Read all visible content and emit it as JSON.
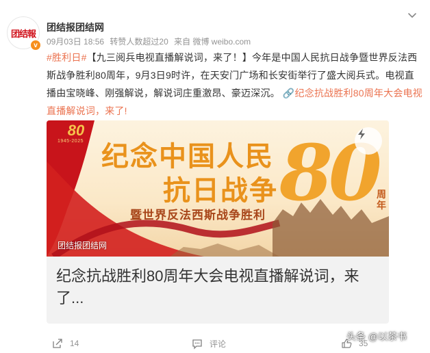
{
  "account": {
    "avatar_text": "团结報",
    "verified_mark": "v",
    "name": "团结报团结网"
  },
  "meta": {
    "time": "09月03日 18:56",
    "reposts": "转赞人数超过20",
    "source": "来自 微博 weibo.com"
  },
  "post": {
    "hashtag": "#胜利日#",
    "body": "【九三阅兵电视直播解说词，来了！】今年是中国人民抗日战争暨世界反法西斯战争胜利80周年，9月3日9时许，在天安门广场和长安街举行了盛大阅兵式。电视直播由宝晓峰、刚强解说，解说词庄重激昂、豪迈深沉。",
    "link_text": "纪念抗战胜利80周年大会电视直播解说词，来了!"
  },
  "card": {
    "image_badge": "80",
    "image_badge_years": "1945-2025",
    "image_title_1": "纪念中国人民",
    "image_title_2": "抗日战争",
    "image_subtitle": "暨世界反法西斯战争胜利",
    "image_big": "80",
    "image_suffix": "周年",
    "image_watermark": "团结报团结网",
    "title": "纪念抗战胜利80周年大会电视直播解说词，来了..."
  },
  "actions": {
    "share_count": "14",
    "comment_label": "评论",
    "like_count": "35"
  },
  "overlay": {
    "brand": "头条 @以茶书"
  },
  "colors": {
    "accent": "#eb7350",
    "brand_red": "#d0111b",
    "verified": "#f78f1e",
    "meta_gray": "#939393"
  },
  "icons": [
    "chevron-down-icon",
    "play-badge-icon",
    "share-icon",
    "comment-icon",
    "like-icon"
  ]
}
